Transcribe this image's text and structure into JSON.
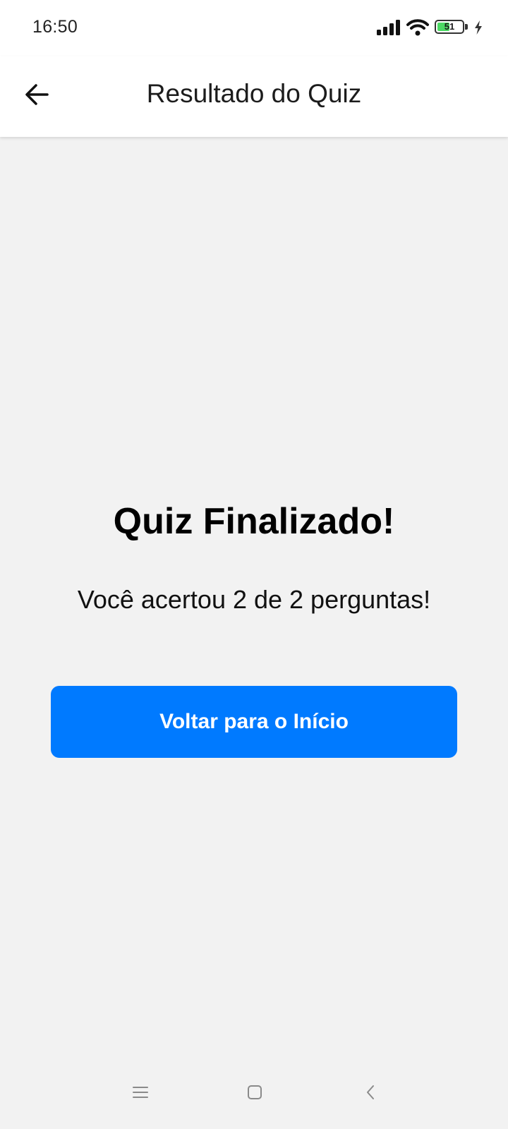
{
  "status_bar": {
    "time": "16:50",
    "battery_level": "51",
    "battery_fraction": 0.51,
    "icons": [
      "signal-icon",
      "wifi-icon",
      "battery-icon",
      "charging-bolt-icon"
    ]
  },
  "app_bar": {
    "title": "Resultado do Quiz",
    "back_icon": "arrow-left-icon"
  },
  "result": {
    "title": "Quiz Finalizado!",
    "message": "Você acertou 2 de 2 perguntas!",
    "button_label": "Voltar para o Início"
  },
  "nav_bar": {
    "icons": [
      "menu-icon",
      "home-square-icon",
      "back-chevron-icon"
    ]
  },
  "colors": {
    "primary": "#007aff",
    "background": "#f2f2f2",
    "surface": "#ffffff",
    "battery_fill": "#4cd964"
  }
}
